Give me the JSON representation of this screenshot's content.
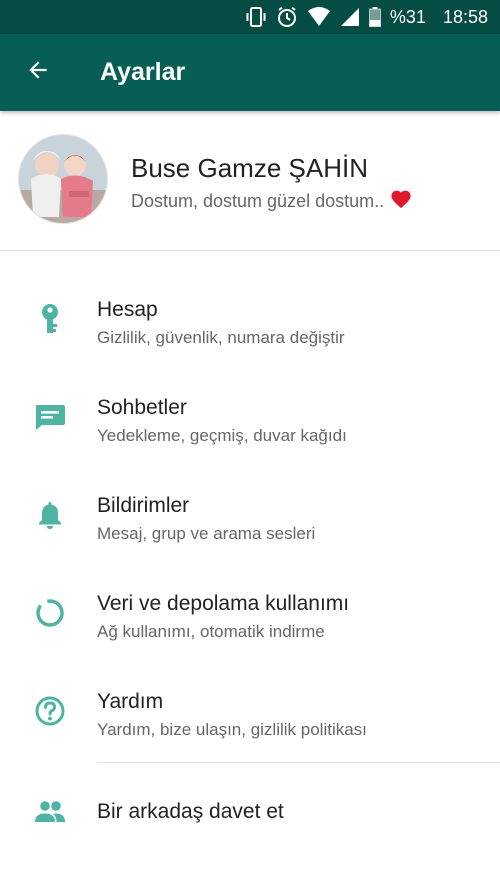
{
  "status_bar": {
    "battery_percent": "%31",
    "time": "18:58",
    "icons": [
      "vibrate-icon",
      "alarm-icon",
      "wifi-icon",
      "signal-icon",
      "battery-icon"
    ]
  },
  "header": {
    "title": "Ayarlar",
    "back_icon": "arrow-back-icon"
  },
  "profile": {
    "name": "Buse Gamze ŞAHİN",
    "status": "Dostum, dostum güzel dostum..",
    "status_emoji": "heart-icon"
  },
  "menu": {
    "items": [
      {
        "icon": "key-icon",
        "title": "Hesap",
        "subtitle": "Gizlilik, güvenlik, numara değiştir"
      },
      {
        "icon": "chat-icon",
        "title": "Sohbetler",
        "subtitle": "Yedekleme, geçmiş, duvar kağıdı"
      },
      {
        "icon": "bell-icon",
        "title": "Bildirimler",
        "subtitle": "Mesaj, grup ve arama sesleri"
      },
      {
        "icon": "data-usage-icon",
        "title": "Veri ve depolama kullanımı",
        "subtitle": "Ağ kullanımı, otomatik indirme"
      },
      {
        "icon": "help-icon",
        "title": "Yardım",
        "subtitle": "Yardım, bize ulaşın, gizlilik politikası"
      }
    ],
    "invite": {
      "icon": "people-icon",
      "title": "Bir arkadaş davet et"
    }
  },
  "colors": {
    "statusbar": "#054d44",
    "appbar": "#075e54",
    "icon_teal": "#4fb3a4",
    "heart": "#e0182d"
  }
}
